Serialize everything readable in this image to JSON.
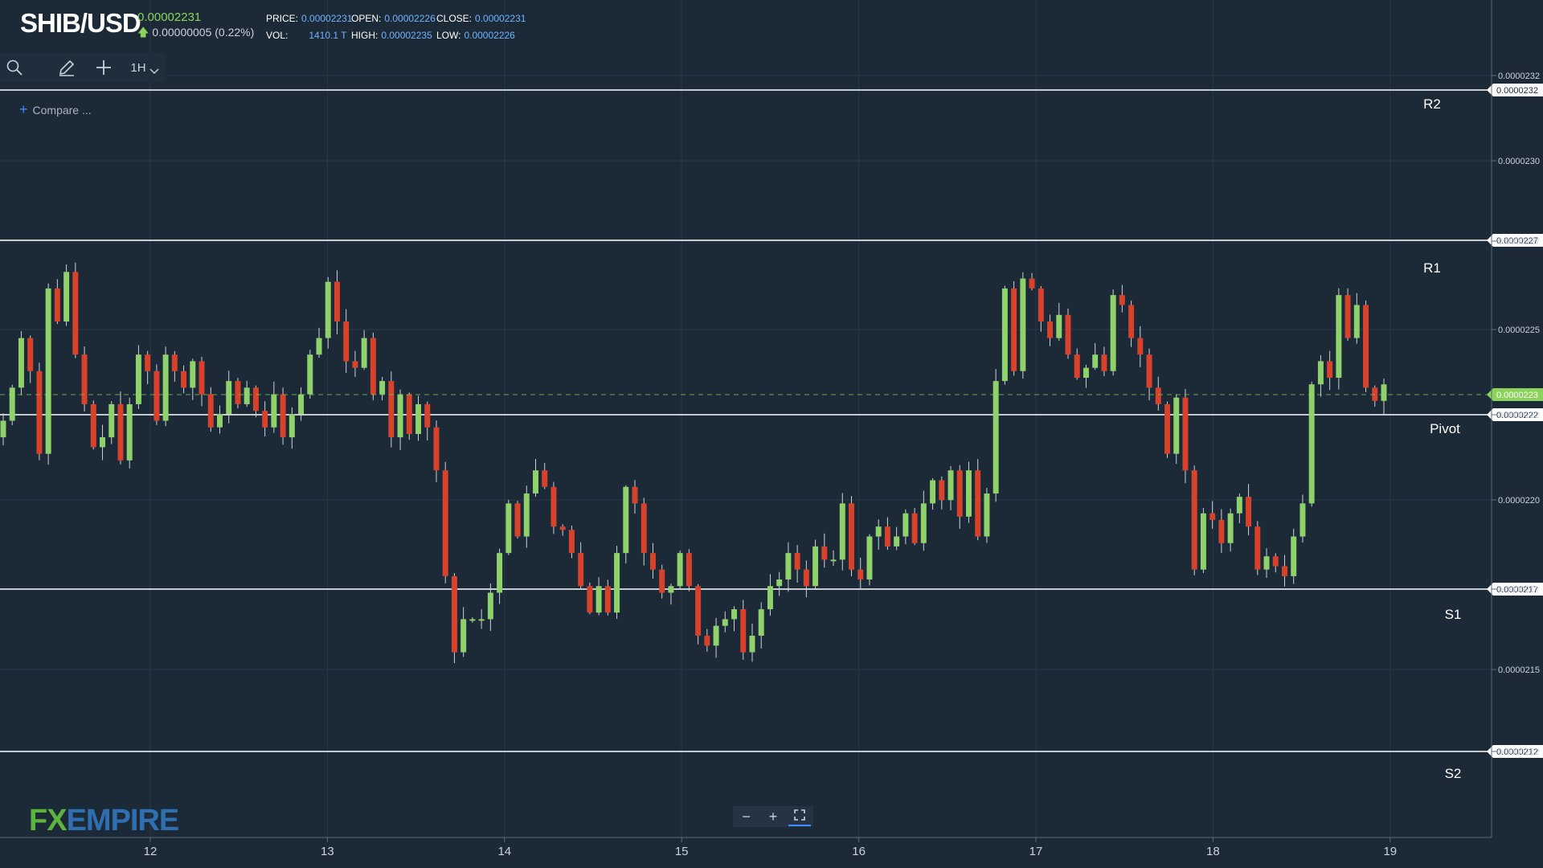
{
  "header": {
    "symbol": "SHIB/USD",
    "last_price": "0.00002231",
    "change": "0.00000005 (0.22%)",
    "price_label": "PRICE:",
    "price_value": "0.00002231",
    "open_label": "OPEN:",
    "open_value": "0.00002226",
    "close_label": "CLOSE:",
    "close_value": "0.00002231",
    "vol_label": "VOL:",
    "vol_value": "1410.1 T",
    "high_label": "HIGH:",
    "high_value": "0.00002235",
    "low_label": "LOW:",
    "low_value": "0.00002226"
  },
  "toolbar": {
    "timeframe": "1H",
    "compare_label": "Compare ..."
  },
  "logo": {
    "part1": "FX",
    "part2": "EMPIRE"
  },
  "colors": {
    "background": "#1c2a38",
    "up": "#8fd16a",
    "down": "#d8412a",
    "level_line": "#ffffff",
    "current_price": "#8bd35a"
  },
  "chart_data": {
    "type": "candlestick",
    "timeframe": "1H",
    "x_ticks": [
      "12",
      "13",
      "14",
      "15",
      "16",
      "17",
      "18",
      "19"
    ],
    "y_axis_labels": [
      "0.0000232",
      "0.0000230",
      "0.0000227",
      "0.0000225",
      "0.0000222",
      "0.0000220",
      "0.0000217",
      "0.0000215",
      "0.0000212"
    ],
    "ylim": [
      2.108e-05,
      2.328e-05
    ],
    "current_price": {
      "value": 2.231e-05,
      "label": "0.0000223"
    },
    "levels": [
      {
        "name": "R2",
        "value": 2.32e-05,
        "label": "0.0000232"
      },
      {
        "name": "R1",
        "value": 2.27e-05,
        "label": "0.0000227"
      },
      {
        "name": "Pivot",
        "value": 2.22e-05,
        "label": "0.0000222"
      },
      {
        "name": "S1",
        "value": 2.17e-05,
        "label": "0.0000217"
      },
      {
        "name": "S2",
        "value": 2.12e-05,
        "label": "0.0000212"
      }
    ],
    "closes": [
      2.22e-05,
      2.23e-05,
      2.245e-05,
      2.235e-05,
      2.21e-05,
      2.26e-05,
      2.25e-05,
      2.265e-05,
      2.24e-05,
      2.225e-05,
      2.212e-05,
      2.215e-05,
      2.225e-05,
      2.208e-05,
      2.225e-05,
      2.24e-05,
      2.235e-05,
      2.22e-05,
      2.24e-05,
      2.235e-05,
      2.23e-05,
      2.238e-05,
      2.228e-05,
      2.218e-05,
      2.222e-05,
      2.232e-05,
      2.225e-05,
      2.23e-05,
      2.223e-05,
      2.218e-05,
      2.228e-05,
      2.215e-05,
      2.222e-05,
      2.228e-05,
      2.24e-05,
      2.245e-05,
      2.262e-05,
      2.25e-05,
      2.238e-05,
      2.236e-05,
      2.245e-05,
      2.228e-05,
      2.232e-05,
      2.215e-05,
      2.228e-05,
      2.216e-05,
      2.225e-05,
      2.218e-05,
      2.205e-05,
      2.173e-05,
      2.15e-05,
      2.16e-05,
      2.16e-05,
      2.16e-05,
      2.168e-05,
      2.18e-05,
      2.195e-05,
      2.185e-05,
      2.198e-05,
      2.205e-05,
      2.2e-05,
      2.188e-05,
      2.187e-05,
      2.18e-05,
      2.17e-05,
      2.162e-05,
      2.17e-05,
      2.162e-05,
      2.18e-05,
      2.2e-05,
      2.195e-05,
      2.18e-05,
      2.175e-05,
      2.168e-05,
      2.17e-05,
      2.18e-05,
      2.17e-05,
      2.155e-05,
      2.152e-05,
      2.158e-05,
      2.16e-05,
      2.163e-05,
      2.15e-05,
      2.155e-05,
      2.163e-05,
      2.17e-05,
      2.172e-05,
      2.18e-05,
      2.175e-05,
      2.17e-05,
      2.182e-05,
      2.178e-05,
      2.178e-05,
      2.195e-05,
      2.175e-05,
      2.172e-05,
      2.185e-05,
      2.188e-05,
      2.182e-05,
      2.185e-05,
      2.192e-05,
      2.183e-05,
      2.195e-05,
      2.202e-05,
      2.196e-05,
      2.205e-05,
      2.191e-05,
      2.205e-05,
      2.185e-05,
      2.198e-05,
      2.232e-05,
      2.26e-05,
      2.235e-05,
      2.263e-05,
      2.26e-05,
      2.25e-05,
      2.245e-05,
      2.252e-05,
      2.24e-05,
      2.233e-05,
      2.236e-05,
      2.24e-05,
      2.235e-05,
      2.258e-05,
      2.255e-05,
      2.245e-05,
      2.24e-05,
      2.23e-05,
      2.225e-05,
      2.21e-05,
      2.227e-05,
      2.205e-05,
      2.175e-05,
      2.192e-05,
      2.19e-05,
      2.183e-05,
      2.192e-05,
      2.197e-05,
      2.188e-05,
      2.175e-05,
      2.179e-05,
      2.176e-05,
      2.173e-05,
      2.185e-05,
      2.195e-05,
      2.231e-05,
      2.238e-05,
      2.233e-05,
      2.258e-05,
      2.245e-05,
      2.255e-05,
      2.23e-05,
      2.226e-05,
      2.231e-05
    ]
  }
}
